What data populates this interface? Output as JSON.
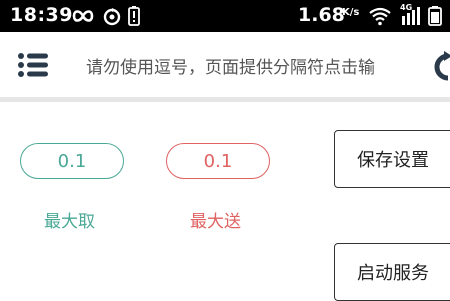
{
  "status_bar": {
    "time": "18:39",
    "speed_value": "1.68",
    "speed_unit": "K/s",
    "network_type": "4G"
  },
  "toolbar": {
    "menu_icon": "hamburger-menu-icon",
    "search_text": "请勿使用逗号，页面提供分隔符点击输",
    "refresh_icon": "refresh-icon"
  },
  "values": {
    "take_value": "0.1",
    "take_label": "最大取",
    "send_value": "0.1",
    "send_label": "最大送"
  },
  "buttons": {
    "save_label": "保存设置",
    "start_label": "启动服务"
  },
  "colors": {
    "take": "#4aa896",
    "send": "#e06262",
    "status_bar": "#000000"
  }
}
